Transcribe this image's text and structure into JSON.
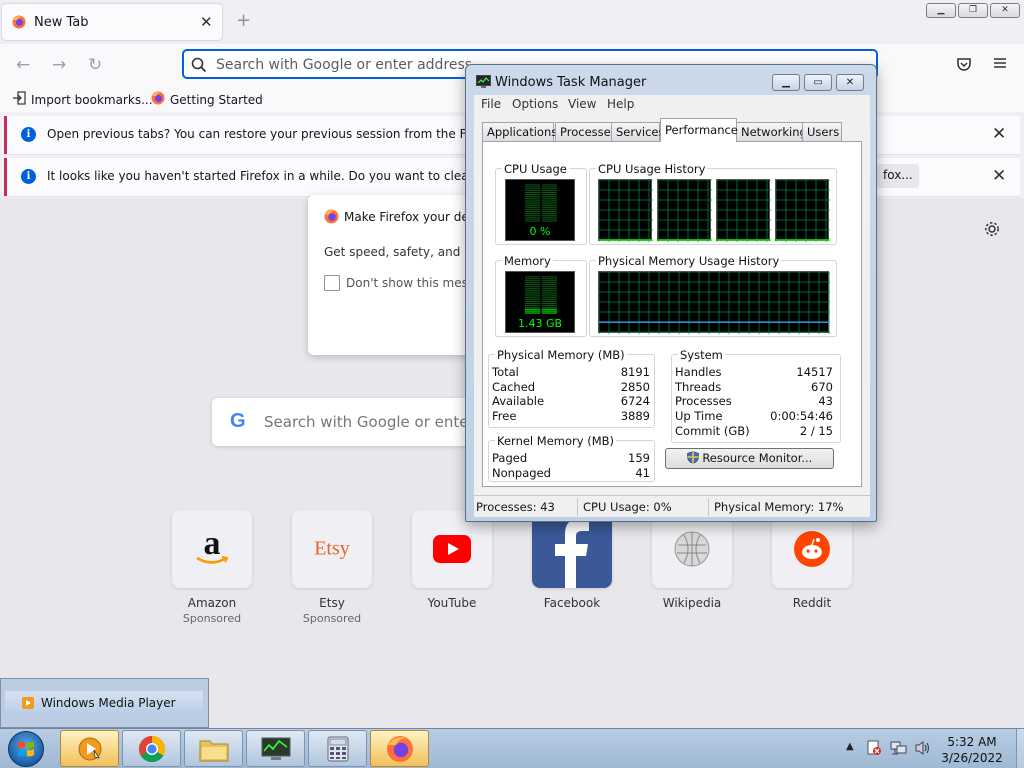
{
  "firefox": {
    "tab_title": "New Tab",
    "tab_close": "✕",
    "new_tab": "+",
    "window_buttons": {
      "minimize": "▁",
      "restore": "❐",
      "close": "✕"
    },
    "url_placeholder": "Search with Google or enter address",
    "bookmarks": [
      "Import bookmarks...",
      "Getting Started"
    ],
    "notices": [
      {
        "message": "Open previous tabs? You can restore your previous session from the Firefox appl",
        "close": "✕"
      },
      {
        "message": "It looks like you haven't started Firefox in a while. Do you want to clean it up for",
        "action": "fox...",
        "close": "✕"
      }
    ],
    "modal": {
      "title": "Make Firefox your defa",
      "body": "Get speed, safety, and priva",
      "checkbox_label": "Don't show this messa"
    },
    "search_placeholder": "Search with Google or enter ad",
    "top_sites": [
      {
        "name": "Amazon",
        "sponsored": "Sponsored"
      },
      {
        "name": "Etsy",
        "sponsored": "Sponsored"
      },
      {
        "name": "YouTube"
      },
      {
        "name": "Facebook"
      },
      {
        "name": "Wikipedia"
      },
      {
        "name": "Reddit"
      }
    ],
    "etsy_logo": "Etsy",
    "amazon_logo": "a"
  },
  "task_manager": {
    "title": "Windows Task Manager",
    "menu": [
      "File",
      "Options",
      "View",
      "Help"
    ],
    "tabs": [
      "Applications",
      "Processes",
      "Services",
      "Performance",
      "Networking",
      "Users"
    ],
    "active_tab": "Performance",
    "cpu_usage_label": "CPU Usage",
    "cpu_usage_value": "0 %",
    "cpu_usage_fraction": 0.0,
    "cpu_history_label": "CPU Usage History",
    "memory_label": "Memory",
    "memory_value": "1.43 GB",
    "memory_fraction": 0.17,
    "memory_history_label": "Physical Memory Usage History",
    "physical_memory": {
      "label": "Physical Memory (MB)",
      "rows": [
        {
          "k": "Total",
          "v": "8191"
        },
        {
          "k": "Cached",
          "v": "2850"
        },
        {
          "k": "Available",
          "v": "6724"
        },
        {
          "k": "Free",
          "v": "3889"
        }
      ]
    },
    "kernel_memory": {
      "label": "Kernel Memory (MB)",
      "rows": [
        {
          "k": "Paged",
          "v": "159"
        },
        {
          "k": "Nonpaged",
          "v": "41"
        }
      ]
    },
    "system": {
      "label": "System",
      "rows": [
        {
          "k": "Handles",
          "v": "14517"
        },
        {
          "k": "Threads",
          "v": "670"
        },
        {
          "k": "Processes",
          "v": "43"
        },
        {
          "k": "Up Time",
          "v": "0:00:54:46"
        },
        {
          "k": "Commit (GB)",
          "v": "2 / 15"
        }
      ]
    },
    "resource_monitor_button": "Resource Monitor...",
    "status": {
      "processes": "Processes: 43",
      "cpu": "CPU Usage: 0%",
      "memory": "Physical Memory: 17%"
    }
  },
  "wmp_popup": {
    "title": "Windows Media Player"
  },
  "taskbar": {
    "time": "5:32 AM",
    "date": "3/26/2022",
    "tray_up": "▲"
  },
  "colors": {
    "firefox_accent": "#0061e0",
    "notice_bar": "#c0305e",
    "scope_green": "#00ff00",
    "scope_grid": "#008040",
    "taskbar": "#a9c0da"
  }
}
